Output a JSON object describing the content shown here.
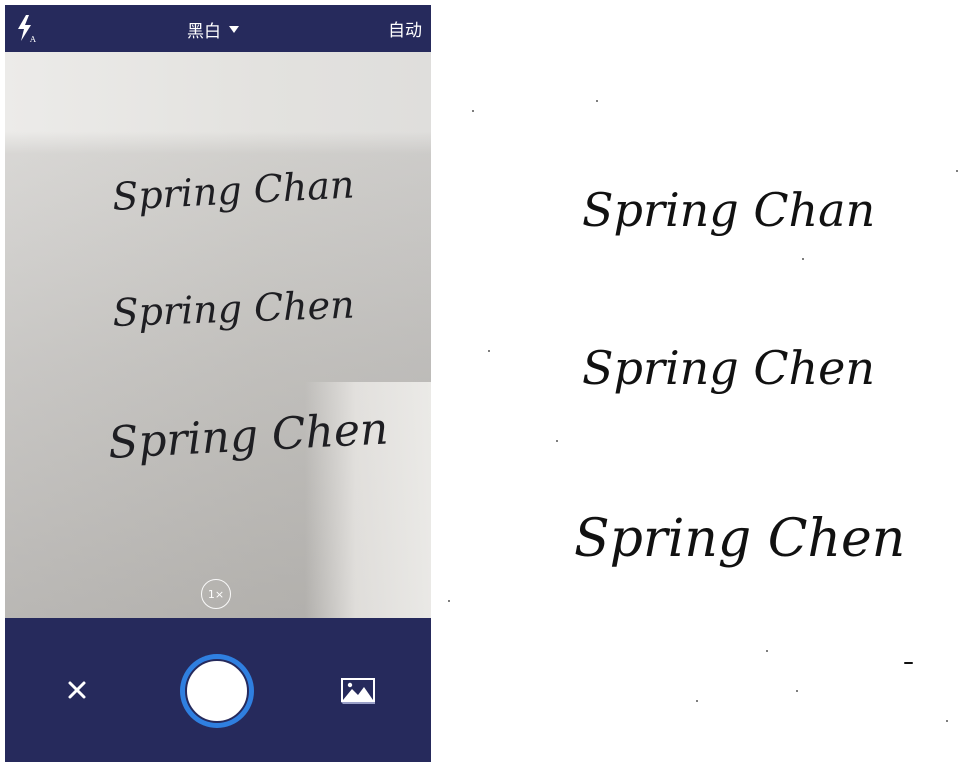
{
  "camera": {
    "topbar": {
      "flash_icon": "flash-auto-icon",
      "mode_label": "黑白",
      "mode_dropdown_icon": "caret-down-icon",
      "auto_label": "自动"
    },
    "viewfinder": {
      "lines": [
        "Spring Chan",
        "Spring Chen",
        "Spring Chen"
      ],
      "zoom_label": "1×"
    },
    "bottombar": {
      "close_icon": "close-icon",
      "shutter_icon": "shutter-icon",
      "gallery_icon": "gallery-icon"
    }
  },
  "scan": {
    "lines": [
      "Spring Chan",
      "Spring Chen",
      "Spring Chen"
    ]
  },
  "colors": {
    "bar": "#262a5c",
    "shutter_ring": "#2f7fe0",
    "ink": "#111111"
  }
}
